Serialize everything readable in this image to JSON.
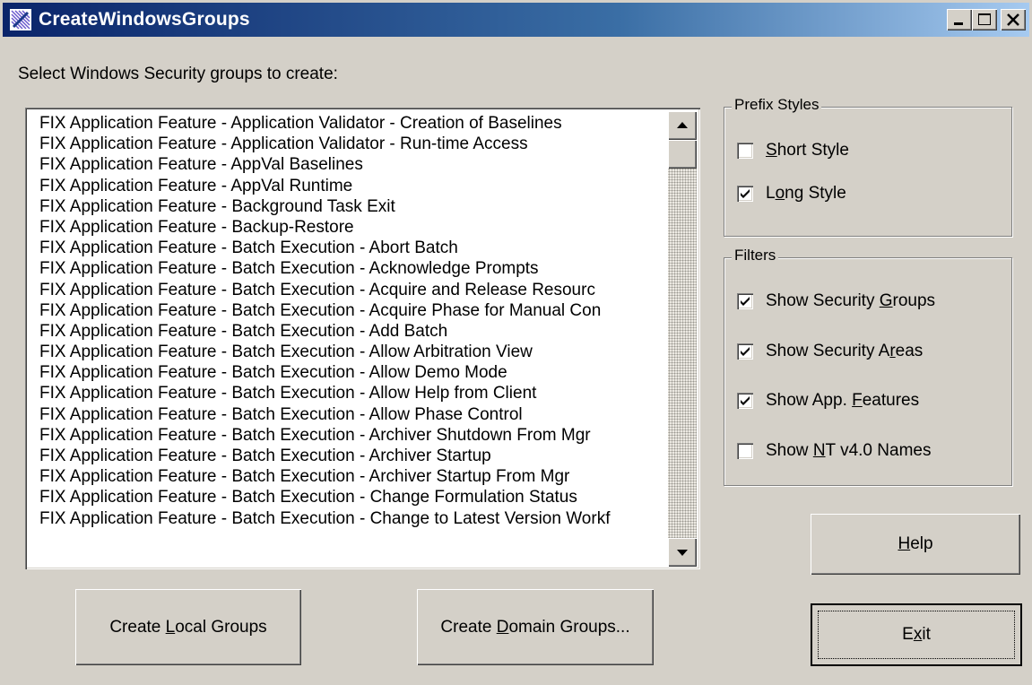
{
  "window": {
    "title": "CreateWindowsGroups",
    "minimize": "_",
    "maximize": "□",
    "close": "X"
  },
  "prompt": "Select Windows Security groups to create:",
  "list": {
    "items": [
      "FIX Application Feature - Application Validator - Creation of Baselines",
      "FIX Application Feature - Application Validator - Run-time Access",
      "FIX Application Feature - AppVal Baselines",
      "FIX Application Feature - AppVal Runtime",
      "FIX Application Feature - Background Task Exit",
      "FIX Application Feature - Backup-Restore",
      "FIX Application Feature - Batch Execution - Abort Batch",
      "FIX Application Feature - Batch Execution - Acknowledge Prompts",
      "FIX Application Feature - Batch Execution - Acquire and Release Resourc",
      "FIX Application Feature - Batch Execution - Acquire Phase for Manual Con",
      "FIX Application Feature - Batch Execution - Add Batch",
      "FIX Application Feature - Batch Execution - Allow Arbitration View",
      "FIX Application Feature - Batch Execution - Allow Demo Mode",
      "FIX Application Feature - Batch Execution - Allow Help from Client",
      "FIX Application Feature - Batch Execution - Allow Phase Control",
      "FIX Application Feature - Batch Execution - Archiver Shutdown From Mgr",
      "FIX Application Feature - Batch Execution - Archiver Startup",
      "FIX Application Feature - Batch Execution - Archiver Startup From Mgr",
      "FIX Application Feature - Batch Execution - Change Formulation Status",
      "FIX Application Feature - Batch Execution - Change to Latest Version Workf"
    ]
  },
  "prefix_styles": {
    "legend": "Prefix Styles",
    "short": {
      "pre": "",
      "key": "S",
      "post": "hort Style",
      "checked": false
    },
    "long": {
      "pre": "L",
      "key": "o",
      "post": "ng Style",
      "checked": true
    }
  },
  "filters": {
    "legend": "Filters",
    "groups": {
      "pre": "Show Security ",
      "key": "G",
      "post": "roups",
      "checked": true
    },
    "areas": {
      "pre": "Show Security A",
      "key": "r",
      "post": "eas",
      "checked": true
    },
    "features": {
      "pre": "Show App. ",
      "key": "F",
      "post": "eatures",
      "checked": true
    },
    "nt": {
      "pre": "Show ",
      "key": "N",
      "post": "T v4.0 Names",
      "checked": false
    }
  },
  "buttons": {
    "local": {
      "pre": "Create ",
      "key": "L",
      "post": "ocal Groups"
    },
    "domain": {
      "pre": "Create ",
      "key": "D",
      "post": "omain Groups..."
    },
    "help": {
      "pre": "",
      "key": "H",
      "post": "elp"
    },
    "exit": {
      "pre": "E",
      "key": "x",
      "post": "it"
    }
  }
}
